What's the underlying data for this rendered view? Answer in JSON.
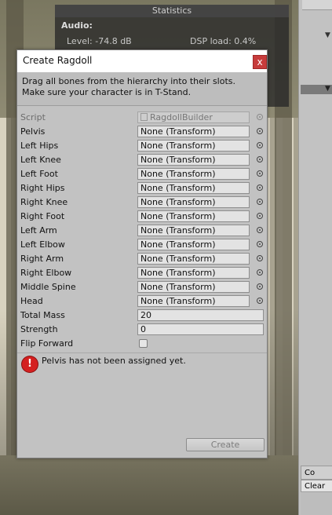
{
  "statistics": {
    "title": "Statistics",
    "audio_label": "Audio:",
    "level": "Level: -74.8 dB",
    "dsp_load": "DSP load: 0.4%"
  },
  "dialog": {
    "title": "Create Ragdoll",
    "close_glyph": "x",
    "help_line1": "Drag all bones from the hierarchy into their slots.",
    "help_line2": "Make sure your character is in T-Stand.",
    "script_label": "Script",
    "script_value": "RagdollBuilder",
    "bones": [
      {
        "label": "Pelvis",
        "value": "None (Transform)"
      },
      {
        "label": "Left Hips",
        "value": "None (Transform)"
      },
      {
        "label": "Left Knee",
        "value": "None (Transform)"
      },
      {
        "label": "Left Foot",
        "value": "None (Transform)"
      },
      {
        "label": "Right Hips",
        "value": "None (Transform)"
      },
      {
        "label": "Right Knee",
        "value": "None (Transform)"
      },
      {
        "label": "Right Foot",
        "value": "None (Transform)"
      },
      {
        "label": "Left Arm",
        "value": "None (Transform)"
      },
      {
        "label": "Left Elbow",
        "value": "None (Transform)"
      },
      {
        "label": "Right Arm",
        "value": "None (Transform)"
      },
      {
        "label": "Right Elbow",
        "value": "None (Transform)"
      },
      {
        "label": "Middle Spine",
        "value": "None (Transform)"
      },
      {
        "label": "Head",
        "value": "None (Transform)"
      }
    ],
    "total_mass_label": "Total Mass",
    "total_mass_value": "20",
    "strength_label": "Strength",
    "strength_value": "0",
    "flip_forward_label": "Flip Forward",
    "flip_forward_checked": false,
    "error_icon_glyph": "!",
    "error_message": "Pelvis has not been assigned yet.",
    "create_label": "Create"
  },
  "side_panel": {
    "console_tab": "Co",
    "clear_label": "Clear"
  },
  "colors": {
    "close_button": "#c73c3c",
    "error_icon": "#d42020",
    "dialog_bg": "#c2c2c2"
  }
}
